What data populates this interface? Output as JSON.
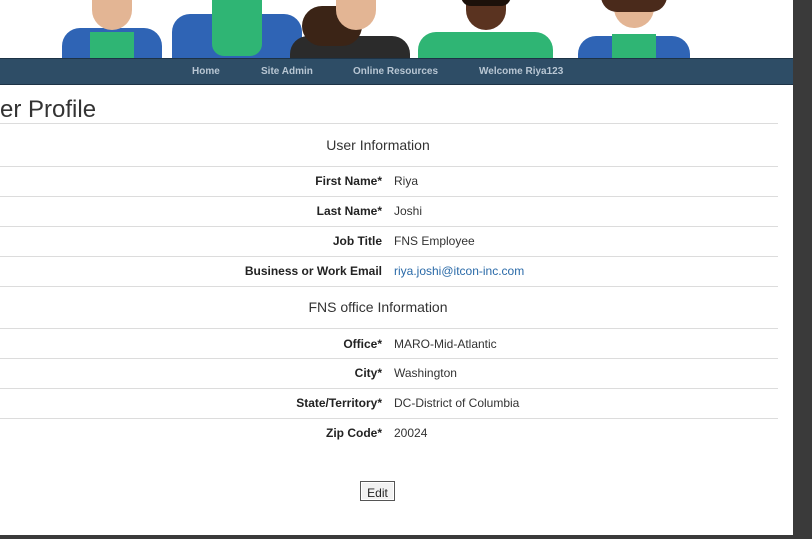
{
  "nav": {
    "items": [
      {
        "label": "Home"
      },
      {
        "label": "Site Admin"
      },
      {
        "label": "Online Resources"
      },
      {
        "label": "Welcome Riya123"
      }
    ]
  },
  "page": {
    "title": "ser Profile"
  },
  "user_info": {
    "heading": "User Information",
    "rows": [
      {
        "label": "First Name*",
        "value": "Riya"
      },
      {
        "label": "Last Name*",
        "value": "Joshi"
      },
      {
        "label": "Job Title",
        "value": "FNS Employee"
      },
      {
        "label": "Business or Work Email",
        "value": "riya.joshi@itcon-inc.com"
      }
    ]
  },
  "office_info": {
    "heading": "FNS office Information",
    "rows": [
      {
        "label": "Office*",
        "value": "MARO-Mid-Atlantic"
      },
      {
        "label": "City*",
        "value": "Washington"
      },
      {
        "label": "State/Territory*",
        "value": "DC-District of Columbia"
      },
      {
        "label": "Zip Code*",
        "value": "20024"
      }
    ]
  },
  "actions": {
    "edit_label": "Edit"
  },
  "colors": {
    "navbar": "#2e4d66",
    "nav_text": "#b8c6d3",
    "link": "#2a6aa8",
    "green_shirt": "#2fb574",
    "blue_vest": "#2f64b5"
  }
}
